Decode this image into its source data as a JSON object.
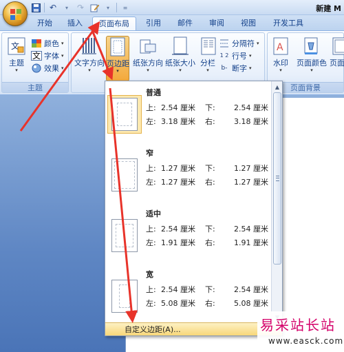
{
  "title": "新建 M",
  "quick_access": {
    "save_icon": "save-icon",
    "undo_icon": "undo-icon",
    "redo_icon": "redo-icon",
    "customize_icon": "customize-icon"
  },
  "tabs": [
    {
      "label": "开始"
    },
    {
      "label": "插入"
    },
    {
      "label": "页面布局"
    },
    {
      "label": "引用"
    },
    {
      "label": "邮件"
    },
    {
      "label": "审阅"
    },
    {
      "label": "视图"
    },
    {
      "label": "开发工具"
    }
  ],
  "ribbon": {
    "theme_group": {
      "label": "主题",
      "theme_button": "主题",
      "colors": "颜色",
      "fonts": "字体",
      "effects": "效果"
    },
    "page_setup_group": {
      "text_direction": "文字方向",
      "margins": "页边距",
      "orientation": "纸张方向",
      "size": "纸张大小",
      "columns": "分栏",
      "breaks": "分隔符",
      "line_numbers": "行号",
      "hyphenation": "断字"
    },
    "page_background_group": {
      "label": "页面背景",
      "watermark": "水印",
      "page_color": "页面颜色",
      "page_borders": "页面边框"
    }
  },
  "margins_gallery": {
    "labels": {
      "top": "上:",
      "bottom": "下:",
      "left": "左:",
      "right": "右:"
    },
    "items": [
      {
        "name": "普通",
        "top": "2.54 厘米",
        "bottom": "2.54 厘米",
        "left": "3.18 厘米",
        "right": "3.18 厘米",
        "selected": true
      },
      {
        "name": "窄",
        "top": "1.27 厘米",
        "bottom": "1.27 厘米",
        "left": "1.27 厘米",
        "right": "1.27 厘米",
        "selected": false
      },
      {
        "name": "适中",
        "top": "2.54 厘米",
        "bottom": "2.54 厘米",
        "left": "1.91 厘米",
        "right": "1.91 厘米",
        "selected": false
      },
      {
        "name": "宽",
        "top": "2.54 厘米",
        "bottom": "2.54 厘米",
        "left": "5.08 厘米",
        "right": "5.08 厘米",
        "selected": false
      }
    ],
    "custom_margins": "自定义边距(A)..."
  },
  "watermark": {
    "site_name": "易采站长站",
    "url": "www.easck.com"
  },
  "colors": {
    "annotation_arrow": "#e8332a",
    "ribbon_text": "#15428b",
    "highlight": "#f8d779"
  }
}
